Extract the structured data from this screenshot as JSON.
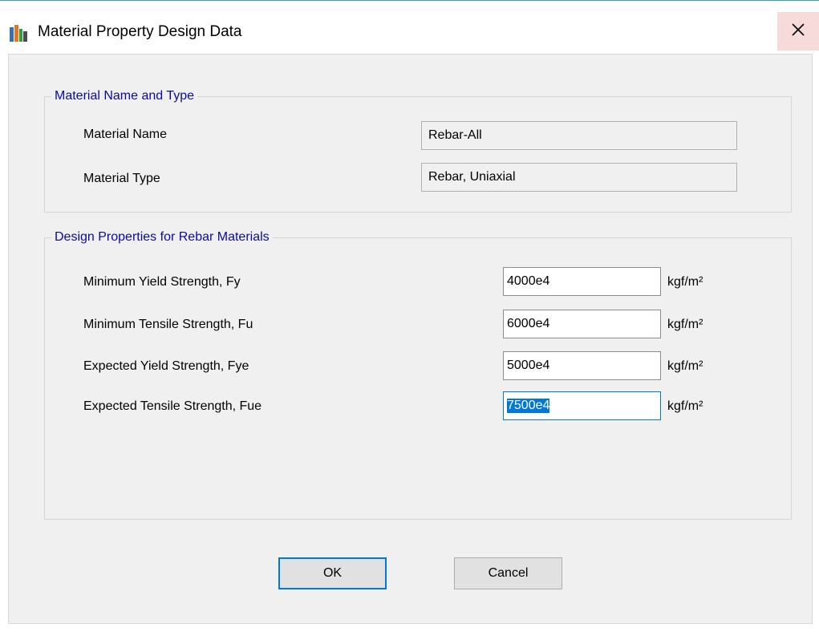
{
  "window": {
    "title": "Material Property Design Data",
    "close_glyph": "✕"
  },
  "icons": {
    "app": "etabs-app-icon",
    "close": "close-icon"
  },
  "colors": {
    "group_title": "#0a0aa0",
    "selection": "#0078d7",
    "close_hover": "#f7dada"
  },
  "material_group": {
    "title": "Material Name and Type",
    "name_label": "Material Name",
    "name_value": "Rebar-All",
    "type_label": "Material Type",
    "type_value": "Rebar, Uniaxial"
  },
  "design_group": {
    "title": "Design Properties for Rebar Materials",
    "rows": [
      {
        "label": "Minimum Yield Strength, Fy",
        "value": "4000e4",
        "unit": "kgf/m²"
      },
      {
        "label": "Minimum Tensile Strength, Fu",
        "value": "6000e4",
        "unit": "kgf/m²"
      },
      {
        "label": "Expected Yield Strength, Fye",
        "value": "5000e4",
        "unit": "kgf/m²"
      },
      {
        "label": "Expected Tensile Strength, Fue",
        "value": "7500e4",
        "unit": "kgf/m²"
      }
    ]
  },
  "buttons": {
    "ok": "OK",
    "cancel": "Cancel"
  }
}
